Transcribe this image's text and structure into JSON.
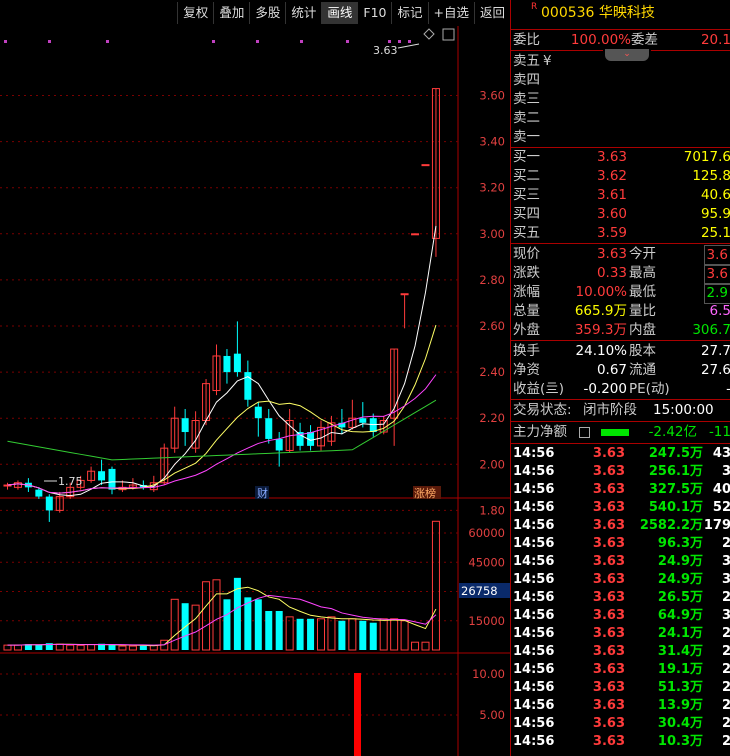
{
  "toolbar": [
    "复权",
    "叠加",
    "多股",
    "统计",
    "画线",
    "F10",
    "标记",
    "+自选",
    "返回"
  ],
  "stock": {
    "marker": "R",
    "code": "000536",
    "name": "华映科技"
  },
  "weibi": {
    "label": "委比",
    "value": "100.00%",
    "label2": "委差",
    "value2": "20.1"
  },
  "sells": [
    {
      "label": "卖五",
      "extra": "¥"
    },
    {
      "label": "卖四"
    },
    {
      "label": "卖三"
    },
    {
      "label": "卖二"
    },
    {
      "label": "卖一"
    }
  ],
  "buys": [
    {
      "label": "买一",
      "price": "3.63",
      "vol": "7017.6"
    },
    {
      "label": "买二",
      "price": "3.62",
      "vol": "125.8"
    },
    {
      "label": "买三",
      "price": "3.61",
      "vol": "40.6"
    },
    {
      "label": "买四",
      "price": "3.60",
      "vol": "95.9"
    },
    {
      "label": "买五",
      "price": "3.59",
      "vol": "25.1"
    }
  ],
  "quote": {
    "xj_l": "现价",
    "xj": "3.63",
    "jk_l": "今开",
    "jk": "3.6",
    "zd_l": "涨跌",
    "zd": "0.33",
    "zg_l": "最高",
    "zg": "3.6",
    "zf_l": "涨幅",
    "zf": "10.00%",
    "zdi_l": "最低",
    "zdi": "2.9",
    "zl_l": "总量",
    "zl": "665.9万",
    "lb_l": "量比",
    "lb": "6.5",
    "wp_l": "外盘",
    "wp": "359.3万",
    "np_l": "内盘",
    "np": "306.7"
  },
  "fund": {
    "hs_l": "换手",
    "hs": "24.10%",
    "gb_l": "股本",
    "gb": "27.7",
    "jz_l": "净资",
    "jz": "0.67",
    "lt_l": "流通",
    "lt": "27.6",
    "sy_l": "收益(亖)",
    "sy": "-0.200",
    "pe_l": "PE(动)",
    "pe": "-"
  },
  "status": {
    "label": "交易状态:",
    "phase": "闭市阶段",
    "time": "15:00:00"
  },
  "mainflow": {
    "label": "主力净额",
    "value": "-2.42亿",
    "value2": "-11"
  },
  "trades": [
    {
      "t": "14:56",
      "p": "3.63",
      "v": "247.5万",
      "n": "43"
    },
    {
      "t": "14:56",
      "p": "3.63",
      "v": "256.1万",
      "n": "3"
    },
    {
      "t": "14:56",
      "p": "3.63",
      "v": "327.5万",
      "n": "40"
    },
    {
      "t": "14:56",
      "p": "3.63",
      "v": "540.1万",
      "n": "52"
    },
    {
      "t": "14:56",
      "p": "3.63",
      "v": "2582.2万",
      "n": "179"
    },
    {
      "t": "14:56",
      "p": "3.63",
      "v": "96.3万",
      "n": "2"
    },
    {
      "t": "14:56",
      "p": "3.63",
      "v": "24.9万",
      "n": "3"
    },
    {
      "t": "14:56",
      "p": "3.63",
      "v": "24.9万",
      "n": "3"
    },
    {
      "t": "14:56",
      "p": "3.63",
      "v": "26.5万",
      "n": "2"
    },
    {
      "t": "14:56",
      "p": "3.63",
      "v": "64.9万",
      "n": "3"
    },
    {
      "t": "14:56",
      "p": "3.63",
      "v": "24.1万",
      "n": "2"
    },
    {
      "t": "14:56",
      "p": "3.63",
      "v": "31.4万",
      "n": "2"
    },
    {
      "t": "14:56",
      "p": "3.63",
      "v": "19.1万",
      "n": "2"
    },
    {
      "t": "14:56",
      "p": "3.63",
      "v": "51.3万",
      "n": "2"
    },
    {
      "t": "14:56",
      "p": "3.63",
      "v": "13.9万",
      "n": "2"
    },
    {
      "t": "14:56",
      "p": "3.63",
      "v": "30.4万",
      "n": "2"
    },
    {
      "t": "14:56",
      "p": "3.63",
      "v": "10.3万",
      "n": "2"
    }
  ],
  "chart_data": {
    "type": "candlestick",
    "price_ticks": [
      "3.60",
      "3.40",
      "3.20",
      "3.00",
      "2.80",
      "2.60",
      "2.40",
      "2.20",
      "2.00",
      "1.80"
    ],
    "high_label": "3.63",
    "low_label": "1.75",
    "markers": [
      {
        "text": "财"
      },
      {
        "text": "涨榜"
      }
    ],
    "vol_ticks": [
      "60000",
      "45000",
      "30000",
      "15000"
    ],
    "vol_current": "26758",
    "ind_ticks": [
      "10.00",
      "5.00"
    ],
    "candles": [
      {
        "o": 1.91,
        "c": 1.91,
        "h": 1.92,
        "l": 1.89
      },
      {
        "o": 1.9,
        "c": 1.92,
        "h": 1.93,
        "l": 1.89
      },
      {
        "o": 1.92,
        "c": 1.9,
        "h": 1.94,
        "l": 1.88
      },
      {
        "o": 1.89,
        "c": 1.86,
        "h": 1.9,
        "l": 1.85
      },
      {
        "o": 1.86,
        "c": 1.8,
        "h": 1.87,
        "l": 1.75
      },
      {
        "o": 1.8,
        "c": 1.86,
        "h": 1.88,
        "l": 1.79
      },
      {
        "o": 1.86,
        "c": 1.9,
        "h": 1.92,
        "l": 1.85
      },
      {
        "o": 1.9,
        "c": 1.93,
        "h": 1.95,
        "l": 1.89
      },
      {
        "o": 1.93,
        "c": 1.97,
        "h": 1.99,
        "l": 1.92
      },
      {
        "o": 1.97,
        "c": 1.93,
        "h": 2.02,
        "l": 1.91
      },
      {
        "o": 1.98,
        "c": 1.89,
        "h": 1.99,
        "l": 1.87
      },
      {
        "o": 1.89,
        "c": 1.9,
        "h": 1.93,
        "l": 1.88
      },
      {
        "o": 1.9,
        "c": 1.91,
        "h": 1.94,
        "l": 1.89
      },
      {
        "o": 1.91,
        "c": 1.9,
        "h": 1.93,
        "l": 1.89
      },
      {
        "o": 1.89,
        "c": 1.92,
        "h": 1.95,
        "l": 1.88
      },
      {
        "o": 1.92,
        "c": 2.07,
        "h": 2.09,
        "l": 1.91
      },
      {
        "o": 2.07,
        "c": 2.2,
        "h": 2.25,
        "l": 2.05
      },
      {
        "o": 2.2,
        "c": 2.14,
        "h": 2.24,
        "l": 2.08
      },
      {
        "o": 2.07,
        "c": 2.19,
        "h": 2.23,
        "l": 2.05
      },
      {
        "o": 2.19,
        "c": 2.35,
        "h": 2.37,
        "l": 2.17
      },
      {
        "o": 2.32,
        "c": 2.47,
        "h": 2.52,
        "l": 2.3
      },
      {
        "o": 2.47,
        "c": 2.4,
        "h": 2.5,
        "l": 2.35
      },
      {
        "o": 2.48,
        "c": 2.4,
        "h": 2.62,
        "l": 2.38
      },
      {
        "o": 2.4,
        "c": 2.28,
        "h": 2.45,
        "l": 2.25
      },
      {
        "o": 2.25,
        "c": 2.2,
        "h": 2.27,
        "l": 2.12
      },
      {
        "o": 2.2,
        "c": 2.11,
        "h": 2.24,
        "l": 2.09
      },
      {
        "o": 2.11,
        "c": 2.06,
        "h": 2.14,
        "l": 1.99
      },
      {
        "o": 2.06,
        "c": 2.19,
        "h": 2.24,
        "l": 2.05
      },
      {
        "o": 2.14,
        "c": 2.08,
        "h": 2.18,
        "l": 2.06
      },
      {
        "o": 2.14,
        "c": 2.08,
        "h": 2.17,
        "l": 2.06
      },
      {
        "o": 2.08,
        "c": 2.16,
        "h": 2.19,
        "l": 2.06
      },
      {
        "o": 2.1,
        "c": 2.18,
        "h": 2.21,
        "l": 2.08
      },
      {
        "o": 2.18,
        "c": 2.16,
        "h": 2.24,
        "l": 2.13
      },
      {
        "o": 2.16,
        "c": 2.2,
        "h": 2.28,
        "l": 2.15
      },
      {
        "o": 2.2,
        "c": 2.18,
        "h": 2.27,
        "l": 2.16
      },
      {
        "o": 2.2,
        "c": 2.14,
        "h": 2.22,
        "l": 2.12
      },
      {
        "o": 2.14,
        "c": 2.19,
        "h": 2.21,
        "l": 2.13
      },
      {
        "o": 2.2,
        "c": 2.5,
        "h": 2.5,
        "l": 2.08
      },
      {
        "o": 2.74,
        "c": 2.74,
        "h": 2.74,
        "l": 2.59
      },
      {
        "o": 3.0,
        "c": 3.0,
        "h": 3.0,
        "l": 3.0
      },
      {
        "o": 3.3,
        "c": 3.3,
        "h": 3.3,
        "l": 3.3
      },
      {
        "o": 2.98,
        "c": 3.63,
        "h": 3.63,
        "l": 2.9
      }
    ]
  }
}
